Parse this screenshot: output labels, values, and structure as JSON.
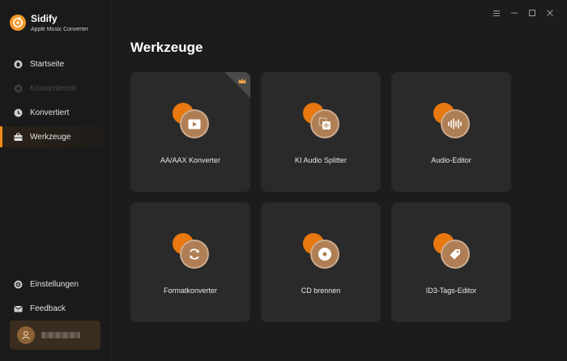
{
  "app": {
    "name": "Sidify",
    "subtitle": "Apple Music Converter"
  },
  "sidebar": {
    "items": [
      {
        "label": "Startseite",
        "icon": "home-icon",
        "state": "normal"
      },
      {
        "label": "Konvertieren",
        "icon": "convert-icon",
        "state": "disabled"
      },
      {
        "label": "Konvertiert",
        "icon": "clock-icon",
        "state": "normal"
      },
      {
        "label": "Werkzeuge",
        "icon": "toolbox-icon",
        "state": "active"
      }
    ],
    "bottom_items": [
      {
        "label": "Einstellungen",
        "icon": "settings-icon"
      },
      {
        "label": "Feedback",
        "icon": "mail-icon"
      }
    ]
  },
  "window_controls": [
    "menu-icon",
    "minimize-icon",
    "maximize-icon",
    "close-icon"
  ],
  "page": {
    "title": "Werkzeuge"
  },
  "tools": [
    {
      "label": "AA/AAX Konverter",
      "icon": "video-play-icon",
      "premium_badge": true
    },
    {
      "label": "KI Audio Splitter",
      "icon": "audio-splitter-icon",
      "premium_badge": false
    },
    {
      "label": "Audio-Editor",
      "icon": "waveform-icon",
      "premium_badge": false
    },
    {
      "label": "Formatkonverter",
      "icon": "refresh-icon",
      "premium_badge": false
    },
    {
      "label": "CD brennen",
      "icon": "cd-icon",
      "premium_badge": false
    },
    {
      "label": "ID3-Tags-Editor",
      "icon": "tag-icon",
      "premium_badge": false
    }
  ],
  "colors": {
    "accent": "#f08a1c",
    "orb": "#e8780f",
    "disc": "#b07e54",
    "card": "#2a2a2a",
    "background": "#1c1c1c"
  }
}
